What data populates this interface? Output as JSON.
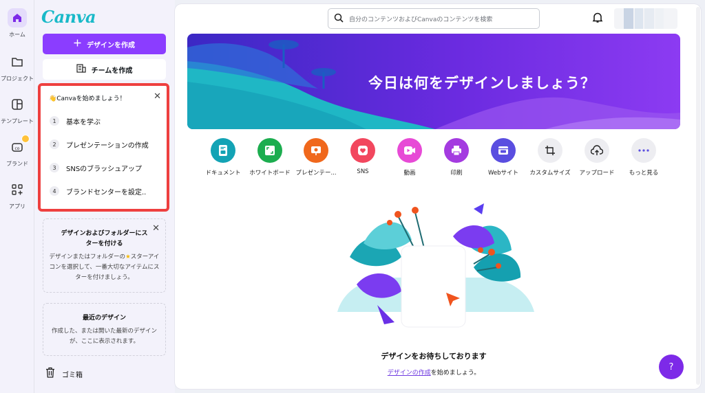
{
  "app": {
    "logo": "Canva",
    "accent": "#8b3dff"
  },
  "rail": {
    "items": [
      {
        "label": "ホーム",
        "icon": "home-icon"
      },
      {
        "label": "プロジェクト",
        "icon": "folder-icon"
      },
      {
        "label": "テンプレート",
        "icon": "template-icon"
      },
      {
        "label": "ブランド",
        "icon": "brand-icon"
      },
      {
        "label": "アプリ",
        "icon": "apps-icon"
      }
    ]
  },
  "sidebar": {
    "create_label": "デザインを作成",
    "team_label": "チームを作成",
    "onboarding": {
      "title": "Canvaを始めましょう！",
      "steps": [
        {
          "num": "1",
          "label": "基本を学ぶ"
        },
        {
          "num": "2",
          "label": "プレゼンテーションの作成"
        },
        {
          "num": "3",
          "label": "SNSのブラッシュアップ"
        },
        {
          "num": "4",
          "label": "ブランドセンターを設定.."
        }
      ]
    },
    "star_card": {
      "title_line1": "デザインおよびフォルダーにス",
      "title_line2": "ターを付ける",
      "body_line1": "デザインまたはフォルダーの",
      "body_line1b": "スターアイ",
      "body_line2": "コンを選択して、一番大切なアイテムにス",
      "body_line3": "ターを付けましょう。"
    },
    "recent_card": {
      "title": "最近のデザイン",
      "body_line1": "作成した、または開いた最新のデザイン",
      "body_line2": "が、ここに表示されます。"
    },
    "trash_label": "ゴミ箱"
  },
  "header": {
    "search_placeholder": "自分のコンテンツおよびCanvaのコンテンツを検索"
  },
  "hero": {
    "title": "今日は何をデザインしましょう？"
  },
  "categories": [
    {
      "label": "ドキュメント",
      "color": "#13a3b5",
      "icon": "document-icon"
    },
    {
      "label": "ホワイトボード",
      "color": "#1cad4f",
      "icon": "whiteboard-icon"
    },
    {
      "label": "プレゼンテー...",
      "color": "#f0681c",
      "icon": "presentation-icon"
    },
    {
      "label": "SNS",
      "color": "#f2475e",
      "icon": "heart-icon"
    },
    {
      "label": "動画",
      "color": "#e74ad6",
      "icon": "video-icon"
    },
    {
      "label": "印刷",
      "color": "#a43be0",
      "icon": "print-icon"
    },
    {
      "label": "Webサイト",
      "color": "#5a4ee0",
      "icon": "website-icon"
    },
    {
      "label": "カスタムサイズ",
      "color": "#ededf1",
      "icon": "custom-size-icon"
    },
    {
      "label": "アップロード",
      "color": "#ededf1",
      "icon": "upload-icon"
    },
    {
      "label": "もっと見る",
      "color": "#ededf1",
      "icon": "more-icon"
    }
  ],
  "empty_state": {
    "title": "デザインをお待ちしております",
    "link": "デザインの作成",
    "suffix": "を始めましょう。"
  },
  "help_label": "?"
}
